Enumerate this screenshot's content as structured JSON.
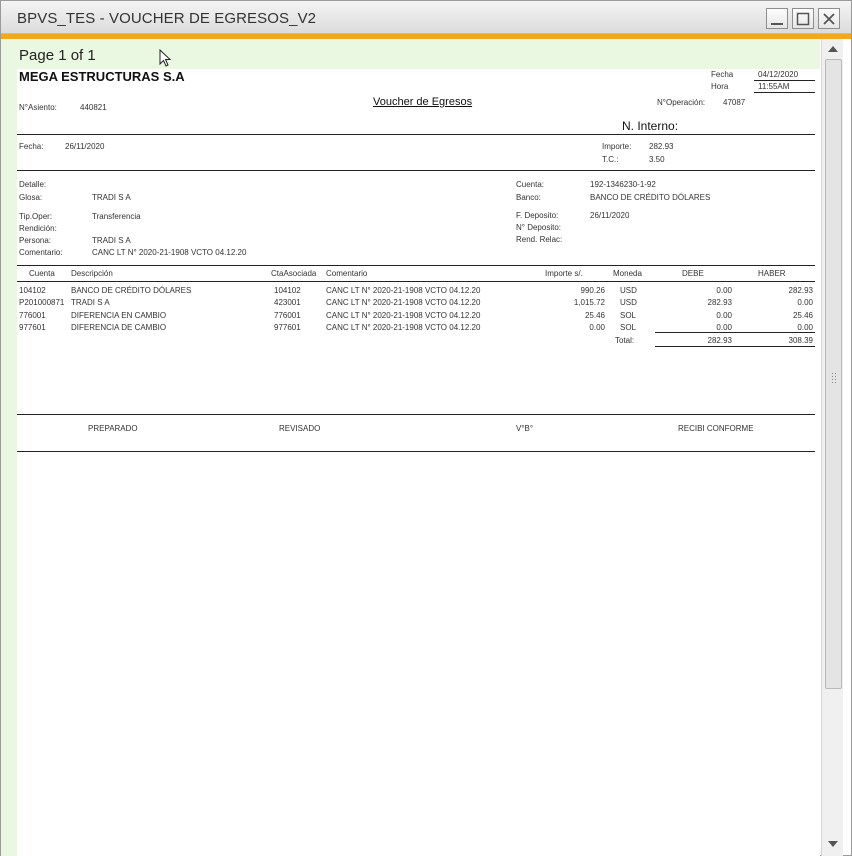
{
  "window": {
    "title": "BPVS_TES - VOUCHER DE EGRESOS_V2",
    "controls": [
      "minimize-icon",
      "maximize-icon",
      "close-icon"
    ]
  },
  "viewer": {
    "page_info": "Page 1 of 1"
  },
  "report": {
    "company": "MEGA ESTRUCTURAS S.A",
    "title": "Voucher de Egresos",
    "fecha_label": "Fecha",
    "fecha_value": "04/12/2020",
    "hora_label": "Hora",
    "hora_value": "11:55AM",
    "asiento_label": "N°Asiento:",
    "asiento_value": "440821",
    "operacion_label": "N°Operación:",
    "operacion_value": "47087",
    "ninterno_label": "N. Interno:",
    "fecha2_label": "Fecha:",
    "fecha2_value": "26/11/2020",
    "importe_label": "Importe:",
    "importe_value": "282.93",
    "tc_label": "T.C.:",
    "tc_value": "3.50",
    "detalle_label": "Detalle:",
    "glosa_label": "Glosa:",
    "glosa_value": "TRADI S A",
    "tipoper_label": "Tip.Oper:",
    "tipoper_value": "Transferencia",
    "rendicion_label": "Rendición:",
    "persona_label": "Persona:",
    "persona_value": "TRADI S A",
    "comentario_label": "Comentario:",
    "comentario_value": "CANC LT N° 2020-21-1908 VCTO 04.12.20",
    "cuenta_label": "Cuenta:",
    "cuenta_value": "192-1346230-1-92",
    "banco_label": "Banco:",
    "banco_value": "BANCO DE CRÉDITO DÓLARES",
    "fdeposito_label": "F. Deposito:",
    "fdeposito_value": "26/11/2020",
    "ndeposito_label": "N° Deposito:",
    "rendrelac_label": "Rend. Relac:",
    "table": {
      "headers": [
        "Cuenta",
        "Descripción",
        "CtaAsociada",
        "Comentario",
        "Importe s/.",
        "Moneda",
        "DEBE",
        "HABER"
      ],
      "rows": [
        [
          "104102",
          "BANCO DE CRÉDITO DÓLARES",
          "104102",
          "CANC LT N° 2020-21-1908 VCTO 04.12.20",
          "990.26",
          "USD",
          "0.00",
          "282.93"
        ],
        [
          "P201000871",
          "TRADI S A",
          "423001",
          "CANC LT N° 2020-21-1908 VCTO 04.12.20",
          "1,015.72",
          "USD",
          "282.93",
          "0.00"
        ],
        [
          "776001",
          "DIFERENCIA EN CAMBIO",
          "776001",
          "CANC LT N° 2020-21-1908 VCTO 04.12.20",
          "25.46",
          "SOL",
          "0.00",
          "25.46"
        ],
        [
          "977601",
          "DIFERENCIA DE CAMBIO",
          "977601",
          "CANC LT N° 2020-21-1908 VCTO 04.12.20",
          "0.00",
          "SOL",
          "0.00",
          "0.00"
        ]
      ],
      "total_label": "Total:",
      "total_debe": "282.93",
      "total_haber": "308.39"
    },
    "signatures": [
      "PREPARADO",
      "REVISADO",
      "V°B°",
      "RECIBI CONFORME"
    ]
  }
}
